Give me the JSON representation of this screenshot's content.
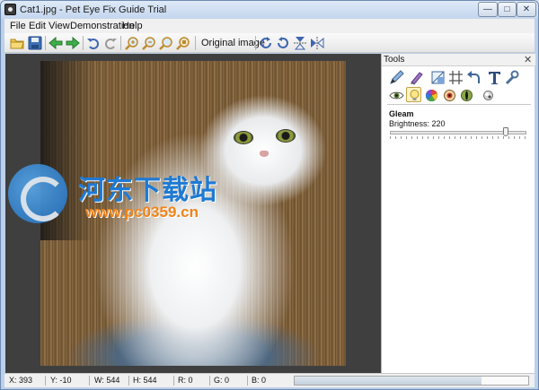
{
  "window": {
    "title": "Cat1.jpg - Pet Eye Fix Guide Trial"
  },
  "window_controls": {
    "minimize": "—",
    "maximize": "□",
    "close": "✕"
  },
  "menu": [
    "File",
    "Edit",
    "View",
    "Demonstration",
    "Help"
  ],
  "toolbar": {
    "buttons": [
      "open-folder-icon",
      "save-icon",
      "back-arrow-icon",
      "forward-arrow-icon",
      "undo-icon",
      "redo-icon",
      "zoom-in-icon",
      "zoom-out-icon",
      "zoom-fit-icon",
      "zoom-actual-icon",
      "rotate-cw-icon",
      "rotate-ccw-icon",
      "flip-vertical-icon",
      "flip-horizontal-icon"
    ],
    "original_image_label": "Original image"
  },
  "tools_panel": {
    "title": "Tools",
    "close": "✕",
    "row1": [
      "pen-icon",
      "eraser-brush-icon",
      "crop-icon",
      "grid-icon",
      "undo-arrow-icon",
      "text-icon",
      "wrench-icon"
    ],
    "row2": [
      "eye-icon",
      "bulb-icon",
      "color-wheel-icon",
      "red-eye-icon",
      "pupil-icon",
      "glare-icon"
    ],
    "active_tool": "bulb-icon",
    "section": "Gleam",
    "brightness_label": "Brightness: 220",
    "brightness": {
      "value": 220,
      "max": 255
    }
  },
  "watermark": {
    "title": "河东下载站",
    "url": "www.pc0359.cn"
  },
  "status": {
    "x": "X: 393",
    "y": "Y: -10",
    "w": "W: 544",
    "h": "H: 544",
    "r": "R: 0",
    "g": "G: 0",
    "b": "B: 0",
    "progress": 0.8
  },
  "colors": {
    "accent": "#1e7ad4",
    "watermark_url": "#f08418",
    "canvas_bg": "#3f3f3f"
  }
}
